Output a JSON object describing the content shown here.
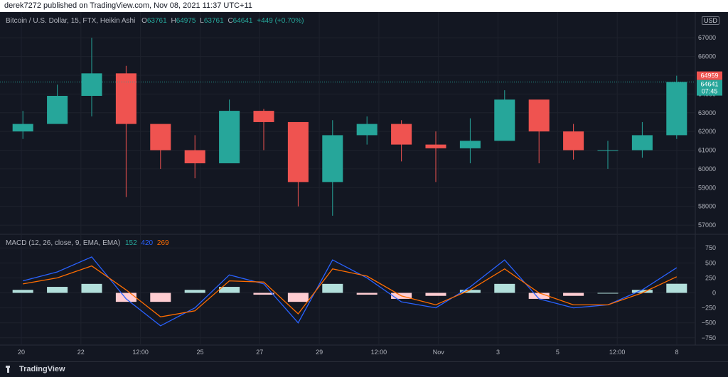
{
  "header": {
    "published": "derek7272 published on TradingView.com, Nov 08, 2021 11:37 UTC+11"
  },
  "legend": {
    "title": "Bitcoin / U.S. Dollar, 15, FTX, Heikin Ashi",
    "o_label": "O",
    "o_value": "63761",
    "h_label": "H",
    "h_value": "64975",
    "l_label": "L",
    "l_value": "63761",
    "c_label": "C",
    "c_value": "64641",
    "change": "+449 (+0.70%)"
  },
  "price_axis": {
    "currency": "USD",
    "ticks": [
      "67000",
      "66000",
      "65000",
      "64000",
      "63000",
      "62000",
      "61000",
      "60000",
      "59000",
      "58000",
      "57000"
    ],
    "high_label": "64959",
    "last_label": "64641",
    "countdown": "07:45"
  },
  "macd_legend": {
    "title": "MACD (12, 26, close, 9, EMA, EMA)",
    "v1": "152",
    "v2": "420",
    "v3": "269"
  },
  "macd_axis": {
    "ticks": [
      "750",
      "500",
      "250",
      "0",
      "−250",
      "−500",
      "−750"
    ]
  },
  "time_axis": {
    "labels": [
      "20",
      "22",
      "12:00",
      "25",
      "27",
      "29",
      "12:00",
      "Nov",
      "3",
      "5",
      "12:00",
      "8"
    ]
  },
  "footer": {
    "brand": "TradingView"
  },
  "colors": {
    "up": "#26a69a",
    "down": "#ef5350",
    "macd": "#2962ff",
    "signal": "#ff6d00",
    "hist_up": "#b2dfdb",
    "hist_down": "#ffcdd2"
  },
  "chart_data": [
    {
      "type": "candlestick",
      "title": "Bitcoin / U.S. Dollar, 15, FTX, Heikin Ashi",
      "ylim": [
        56700,
        67500
      ],
      "x": [
        "20",
        "21",
        "22",
        "23",
        "24",
        "25",
        "26",
        "27",
        "28",
        "29",
        "30",
        "31",
        "Nov 1",
        "2",
        "3",
        "4",
        "5",
        "6",
        "7",
        "8"
      ],
      "close": [
        62400,
        63900,
        65100,
        62400,
        61000,
        60300,
        63100,
        62500,
        59300,
        61800,
        62400,
        61300,
        61100,
        61500,
        63700,
        62000,
        61000,
        61000,
        61800,
        64641
      ],
      "high": [
        63100,
        64500,
        67000,
        65500,
        61900,
        61800,
        63700,
        63200,
        62000,
        62600,
        62800,
        62600,
        62000,
        62700,
        64200,
        63100,
        62400,
        61500,
        62500,
        64975
      ],
      "low": [
        61600,
        62500,
        62800,
        58500,
        60000,
        59500,
        61600,
        61000,
        58000,
        57500,
        61300,
        60400,
        59300,
        60300,
        61800,
        60300,
        60500,
        60000,
        60600,
        61600
      ]
    },
    {
      "type": "line",
      "title": "MACD (12, 26, close, 9, EMA, EMA)",
      "ylim": [
        -800,
        800
      ],
      "x": [
        "20",
        "21",
        "22",
        "23",
        "24",
        "25",
        "26",
        "27",
        "28",
        "29",
        "30",
        "31",
        "Nov 1",
        "2",
        "3",
        "4",
        "5",
        "6",
        "7",
        "8"
      ],
      "series": [
        {
          "name": "MACD",
          "values": [
            200,
            350,
            600,
            -100,
            -550,
            -250,
            300,
            150,
            -500,
            550,
            250,
            -150,
            -250,
            100,
            550,
            -100,
            -250,
            -200,
            50,
            420
          ]
        },
        {
          "name": "Signal",
          "values": [
            150,
            250,
            450,
            50,
            -400,
            -300,
            200,
            180,
            -350,
            400,
            280,
            -50,
            -200,
            50,
            400,
            0,
            -200,
            -200,
            0,
            269
          ]
        },
        {
          "name": "Histogram",
          "values": [
            50,
            100,
            150,
            -150,
            -150,
            50,
            100,
            -30,
            -150,
            150,
            -30,
            -100,
            -50,
            50,
            150,
            -100,
            -50,
            0,
            50,
            152
          ]
        }
      ]
    }
  ]
}
